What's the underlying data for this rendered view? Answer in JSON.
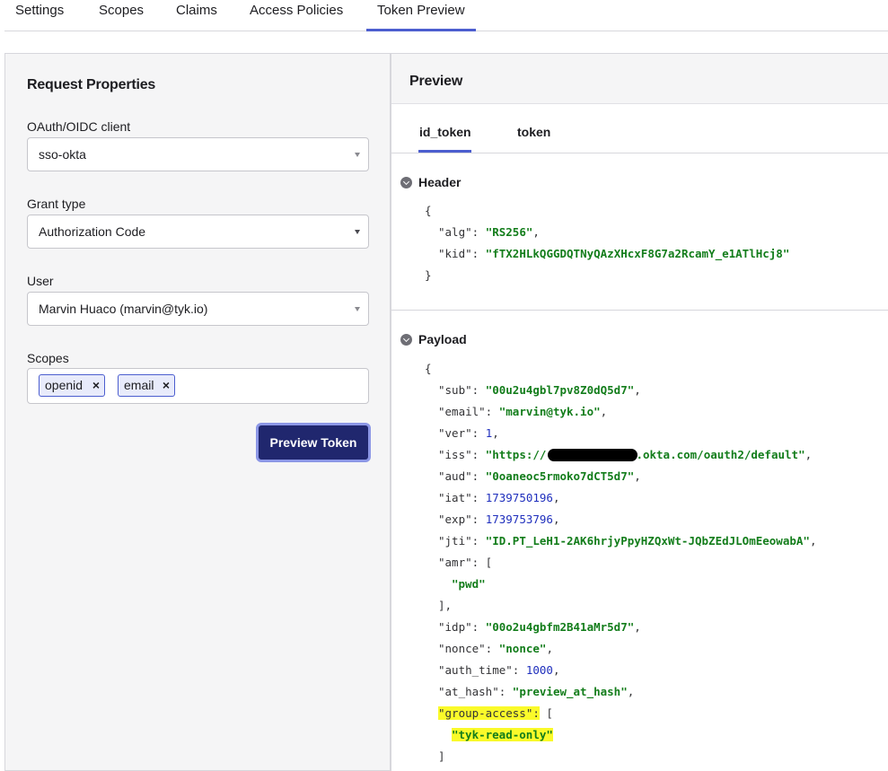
{
  "top_tabs": [
    "Settings",
    "Scopes",
    "Claims",
    "Access Policies",
    "Token Preview"
  ],
  "active_top_tab": "Token Preview",
  "request": {
    "title": "Request Properties",
    "client_label": "OAuth/OIDC client",
    "client_value": "sso-okta",
    "grant_label": "Grant type",
    "grant_value": "Authorization Code",
    "user_label": "User",
    "user_value": "Marvin Huaco (marvin@tyk.io)",
    "scopes_label": "Scopes",
    "scopes": [
      "openid",
      "email"
    ],
    "chip_remove": "×",
    "button": "Preview Token"
  },
  "preview": {
    "title": "Preview",
    "tabs": [
      "id_token",
      "token"
    ],
    "active_tab": "id_token",
    "header_label": "Header",
    "payload_label": "Payload",
    "header": {
      "alg": "RS256",
      "kid": "fTX2HLkQGGDQTNyQAzXHcxF8G7a2RcamY_e1ATlHcj8"
    },
    "payload": {
      "sub": "00u2u4gbl7pv8Z0dQ5d7",
      "email": "marvin@tyk.io",
      "ver": "1",
      "iss_prefix": "https://",
      "iss_suffix": ".okta.com/oauth2/default",
      "aud": "0oaneoc5rmoko7dCT5d7",
      "iat": "1739750196",
      "exp": "1739753796",
      "jti": "ID.PT_LeH1-2AK6hrjyPpyHZQxWt-JQbZEdJLOmEeowabA",
      "amr_item": "pwd",
      "idp": "00o2u4gbfm2B41aMr5d7",
      "nonce": "nonce",
      "auth_time": "1000",
      "at_hash": "preview_at_hash",
      "group_access_item": "tyk-read-only"
    }
  },
  "colors": {
    "accent": "#4c5ecf",
    "button_bg": "#20276e",
    "string": "#137d1b",
    "number": "#1f2fbd",
    "highlight": "#fafa2a"
  }
}
